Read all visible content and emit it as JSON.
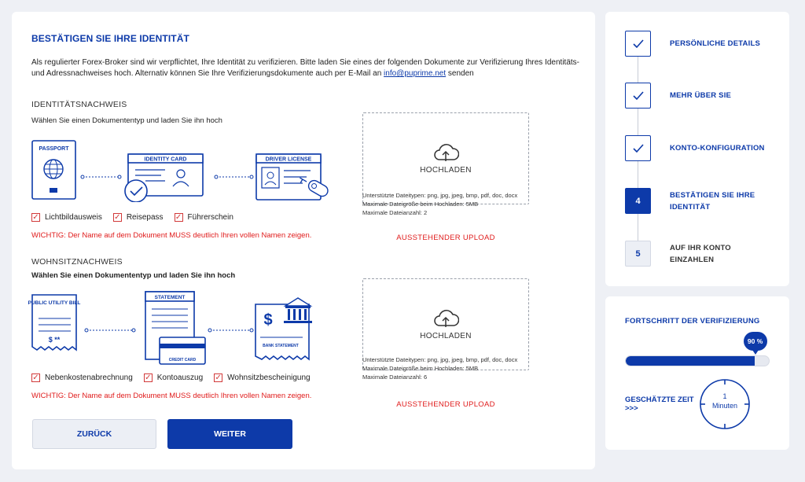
{
  "main": {
    "title": "BESTÄTIGEN SIE IHRE IDENTITÄT",
    "intro_text": "Als regulierter Forex-Broker sind wir verpflichtet, Ihre Identität zu verifizieren. Bitte laden Sie eines der folgenden Dokumente zur Verifizierung Ihres Identitäts- und Adressnachweises hoch. Alternativ können Sie Ihre Verifizierungsdokumente auch per E-Mail an",
    "intro_email": "info@puprime.net",
    "intro_suffix": "senden",
    "identity": {
      "heading": "IDENTITÄTSNACHWEIS",
      "subheading": "Wählen Sie einen Dokumententyp und laden Sie ihn hoch",
      "illustrations": [
        "PASSPORT",
        "IDENTITY CARD",
        "DRIVER LICENSE"
      ],
      "options": [
        "Lichtbildausweis",
        "Reisepass",
        "Führerschein"
      ],
      "warning": "WICHTIG: Der Name auf dem Dokument MUSS deutlich Ihren vollen Namen zeigen.",
      "upload_label": "HOCHLADEN",
      "info": [
        "Unterstützte Dateitypen: png, jpg, jpeg, bmp, pdf, doc, docx",
        "Maximale Dateigröße beim Hochladen: 5MB",
        "Maximale Dateianzahl: 2"
      ],
      "status": "AUSSTEHENDER UPLOAD"
    },
    "address": {
      "heading": "WOHNSITZNACHWEIS",
      "subheading": "Wählen Sie einen Dokumententyp und laden Sie ihn hoch",
      "illustrations": [
        "PUBLIC UTILITY BILL",
        "STATEMENT",
        "CREDIT CARD",
        "BANK STATEMENT"
      ],
      "bill_amount": "$ **",
      "options": [
        "Nebenkostenabrechnung",
        "Kontoauszug",
        "Wohnsitzbescheinigung"
      ],
      "warning": "WICHTIG: Der Name auf dem Dokument MUSS deutlich Ihren vollen Namen zeigen.",
      "upload_label": "HOCHLADEN",
      "info": [
        "Unterstützte Dateitypen: png, jpg, jpeg, bmp, pdf, doc, docx",
        "Maximale Dateigröße beim Hochladen: 5MB",
        "Maximale Dateianzahl: 6"
      ],
      "status": "AUSSTEHENDER UPLOAD"
    },
    "back_label": "ZURÜCK",
    "next_label": "WEITER"
  },
  "steps": [
    {
      "label": "PERSÖNLICHE DETAILS",
      "state": "done"
    },
    {
      "label": "MEHR ÜBER SIE",
      "state": "done"
    },
    {
      "label": "KONTO-KONFIGURATION",
      "state": "done"
    },
    {
      "number": "4",
      "label": "BESTÄTIGEN SIE IHRE IDENTITÄT",
      "state": "active"
    },
    {
      "number": "5",
      "label": "AUF IHR KONTO EINZAHLEN",
      "state": "todo"
    }
  ],
  "progress": {
    "title": "FORTSCHRITT DER VERIFIZIERUNG",
    "percent_label": "90 %",
    "percent_value": 90,
    "estimate_label": "GESCHÄTZTE ZEIT",
    "estimate_arrows": ">>>",
    "estimate_value": "1",
    "estimate_unit": "Minuten"
  },
  "colors": {
    "accent": "#0d3aa9",
    "warning": "#e01b1b",
    "background": "#eef0f5"
  }
}
